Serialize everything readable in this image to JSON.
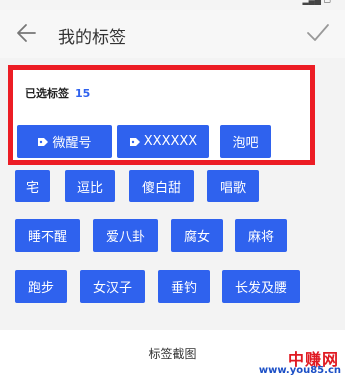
{
  "header": {
    "title": "我的标签"
  },
  "selected": {
    "label": "已选标签",
    "count": "15",
    "tags": [
      {
        "label": "微醒号",
        "icon": "tag-icon"
      },
      {
        "label": "XXXXXX",
        "icon": "tag-icon"
      },
      {
        "label": "泡吧"
      }
    ]
  },
  "tags": {
    "row1": [
      "宅",
      "逗比",
      "傻白甜",
      "唱歌"
    ],
    "row2": [
      "睡不醒",
      "爱八卦",
      "腐女",
      "麻将"
    ],
    "row3": [
      "跑步",
      "女汉子",
      "垂钓",
      "长发及腰"
    ]
  },
  "caption": "标签截图",
  "watermark": {
    "name": "中赚网",
    "url": "www.you85.cn"
  },
  "colors": {
    "accent": "#2f62ee",
    "highlight": "#ec1c24"
  }
}
